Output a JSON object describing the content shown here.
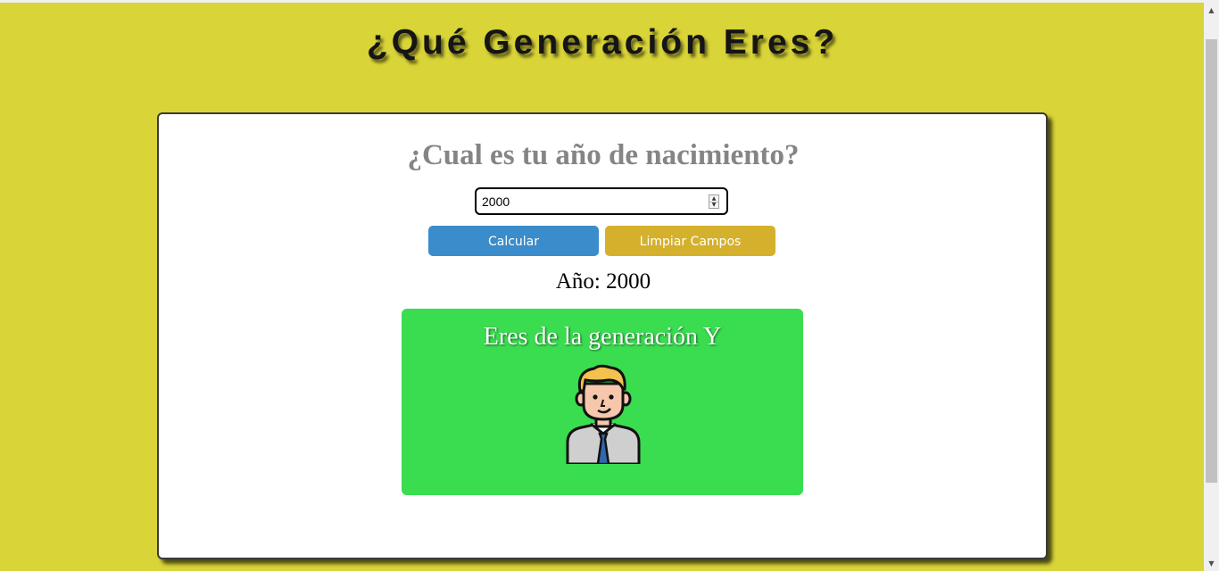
{
  "page": {
    "title": "¿Qué Generación Eres?"
  },
  "form": {
    "question": "¿Cual es tu año de nacimiento?",
    "year_value": "2000",
    "calculate_label": "Calcular",
    "clear_label": "Limpiar Campos"
  },
  "result": {
    "year_text": "Año: 2000",
    "generation_text": "Eres de la generación Y",
    "avatar_icon": "businessman-avatar-icon"
  },
  "colors": {
    "background": "#d9d437",
    "calculate_button": "#3a8ccb",
    "clear_button": "#d4b02c",
    "result_box": "#3adc50",
    "question_text": "#858585"
  }
}
